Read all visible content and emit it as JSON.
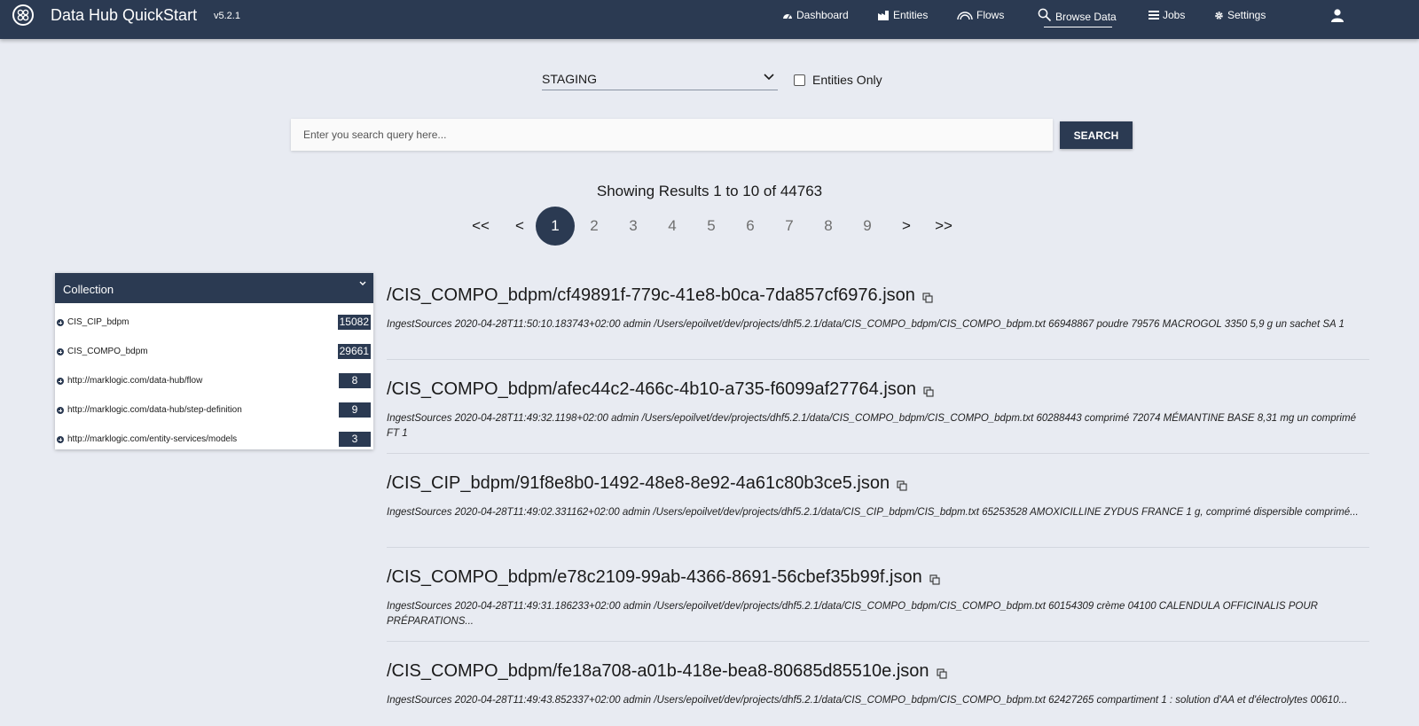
{
  "app": {
    "title": "Data Hub QuickStart",
    "version": "v5.2.1"
  },
  "nav": {
    "dashboard": "Dashboard",
    "entities": "Entities",
    "flows": "Flows",
    "browse": "Browse Data",
    "jobs": "Jobs",
    "settings": "Settings"
  },
  "database": {
    "selected": "STAGING",
    "entities_only_label": "Entities Only"
  },
  "search": {
    "placeholder": "Enter you search query here...",
    "button_label": "SEARCH"
  },
  "results_info": "Showing Results 1 to 10 of 44763",
  "pagination": {
    "first": "<<",
    "prev": "<",
    "next": ">",
    "last": ">>",
    "pages": [
      "1",
      "2",
      "3",
      "4",
      "5",
      "6",
      "7",
      "8",
      "9"
    ],
    "current": "1"
  },
  "facet": {
    "title": "Collection",
    "items": [
      {
        "label": "CIS_CIP_bdpm",
        "count": "15082"
      },
      {
        "label": "CIS_COMPO_bdpm",
        "count": "29661"
      },
      {
        "label": "http://marklogic.com/data-hub/flow",
        "count": "8"
      },
      {
        "label": "http://marklogic.com/data-hub/step-definition",
        "count": "9"
      },
      {
        "label": "http://marklogic.com/entity-services/models",
        "count": "3"
      }
    ]
  },
  "results": [
    {
      "uri": "/CIS_COMPO_bdpm/cf49891f-779c-41e8-b0ca-7da857cf6976.json",
      "snippet": "IngestSources 2020-04-28T11:50:10.183743+02:00 admin /Users/epoilvet/dev/projects/dhf5.2.1/data/CIS_COMPO_bdpm/CIS_COMPO_bdpm.txt 66948867 poudre 79576 MACROGOL 3350 5,9 g un sachet SA 1"
    },
    {
      "uri": "/CIS_COMPO_bdpm/afec44c2-466c-4b10-a735-f6099af27764.json",
      "snippet": "IngestSources 2020-04-28T11:49:32.1198+02:00 admin /Users/epoilvet/dev/projects/dhf5.2.1/data/CIS_COMPO_bdpm/CIS_COMPO_bdpm.txt 60288443 comprimé 72074 MÉMANTINE BASE 8,31 mg un comprimé FT 1"
    },
    {
      "uri": "/CIS_CIP_bdpm/91f8e8b0-1492-48e8-8e92-4a61c80b3ce5.json",
      "snippet": "IngestSources 2020-04-28T11:49:02.331162+02:00 admin /Users/epoilvet/dev/projects/dhf5.2.1/data/CIS_CIP_bdpm/CIS_bdpm.txt 65253528 AMOXICILLINE ZYDUS FRANCE 1 g, comprimé dispersible comprimé..."
    },
    {
      "uri": "/CIS_COMPO_bdpm/e78c2109-99ab-4366-8691-56cbef35b99f.json",
      "snippet": "IngestSources 2020-04-28T11:49:31.186233+02:00 admin /Users/epoilvet/dev/projects/dhf5.2.1/data/CIS_COMPO_bdpm/CIS_COMPO_bdpm.txt 60154309 crème 04100 CALENDULA OFFICINALIS POUR PRÉPARATIONS..."
    },
    {
      "uri": "/CIS_COMPO_bdpm/fe18a708-a01b-418e-bea8-80685d85510e.json",
      "snippet": "IngestSources 2020-04-28T11:49:43.852337+02:00 admin /Users/epoilvet/dev/projects/dhf5.2.1/data/CIS_COMPO_bdpm/CIS_COMPO_bdpm.txt 62427265 compartiment 1 : solution d'AA et d'électrolytes 00610..."
    }
  ]
}
